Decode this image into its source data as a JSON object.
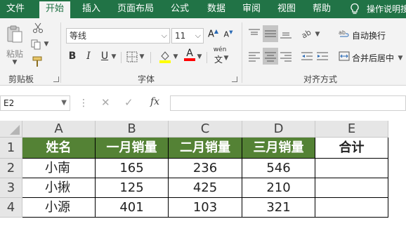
{
  "tabs": [
    {
      "label": "文件",
      "active": false
    },
    {
      "label": "开始",
      "active": true
    },
    {
      "label": "插入",
      "active": false
    },
    {
      "label": "页面布局",
      "active": false
    },
    {
      "label": "公式",
      "active": false
    },
    {
      "label": "数据",
      "active": false
    },
    {
      "label": "审阅",
      "active": false
    },
    {
      "label": "视图",
      "active": false
    },
    {
      "label": "帮助",
      "active": false
    }
  ],
  "tell_me": "操作说明搜",
  "ribbon": {
    "clipboard": {
      "label": "剪贴板",
      "paste": "粘贴"
    },
    "font": {
      "label": "字体",
      "family": "等线",
      "size": "11",
      "grow": "A",
      "shrink": "A",
      "bold": "B",
      "italic": "I",
      "underline": "U",
      "font_color_glyph": "A",
      "phonetic": "wén"
    },
    "alignment": {
      "label": "对齐方式",
      "wrap_text": "自动换行",
      "merge_center": "合并后居中"
    }
  },
  "formula_bar": {
    "name_box": "E2",
    "fx": "fx",
    "formula": ""
  },
  "sheet": {
    "columns": [
      "A",
      "B",
      "C",
      "D",
      "E"
    ],
    "rows": [
      "1",
      "2",
      "3",
      "4"
    ],
    "header_fill": "#548235",
    "header": [
      "姓名",
      "一月销量",
      "二月销量",
      "三月销量",
      "合计"
    ],
    "data": [
      [
        "小南",
        "165",
        "236",
        "546",
        ""
      ],
      [
        "小揪",
        "125",
        "425",
        "210",
        ""
      ],
      [
        "小源",
        "401",
        "103",
        "321",
        ""
      ]
    ],
    "selected_cell": "E2"
  }
}
